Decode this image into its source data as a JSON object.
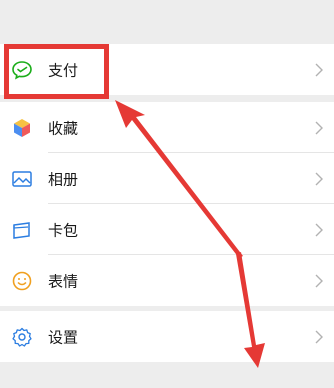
{
  "menu": {
    "pay": {
      "label": "支付",
      "icon": "wechat-pay-icon"
    },
    "favorites": {
      "label": "收藏",
      "icon": "cube-icon"
    },
    "album": {
      "label": "相册",
      "icon": "picture-icon"
    },
    "cards": {
      "label": "卡包",
      "icon": "wallet-card-icon"
    },
    "stickers": {
      "label": "表情",
      "icon": "smiley-icon"
    },
    "settings": {
      "label": "设置",
      "icon": "gear-icon"
    }
  },
  "colors": {
    "background": "#ededed",
    "highlight": "#e53935",
    "pay_icon": "#1aad19",
    "photo_icon": "#2b7de1",
    "cards_icon": "#2b7de1",
    "smile_icon": "#f0a020",
    "settings_icon": "#2b7de1"
  }
}
